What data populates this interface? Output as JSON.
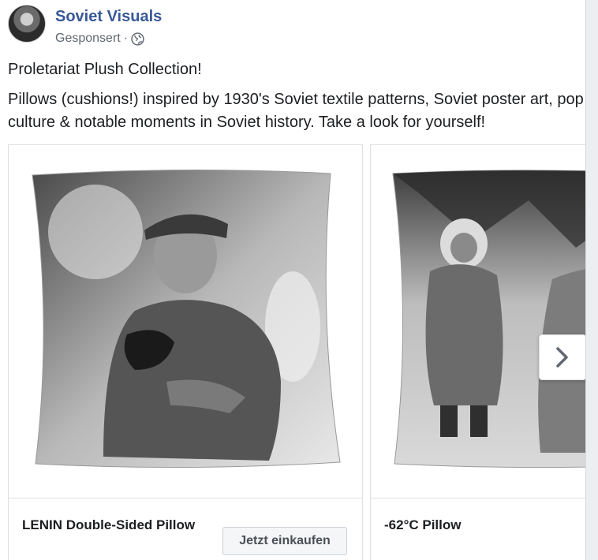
{
  "post": {
    "page_name": "Soviet Visuals",
    "sponsored_label": "Gesponsert",
    "separator": "·",
    "audience_icon": "globe-icon",
    "text_line1": "Proletariat Plush Collection!",
    "text_line2": "Pillows (cushions!) inspired by 1930's Soviet textile patterns, Soviet poster art, pop culture & notable moments in Soviet history. Take a look for yourself!"
  },
  "carousel": {
    "cards": [
      {
        "title": "LENIN Double-Sided Pillow",
        "cta_label": "Jetzt einkaufen",
        "image": "lenin-pillow-photo"
      },
      {
        "title": "-62°C Pillow",
        "image": "children-winter-pillow-photo"
      }
    ],
    "next_icon": "chevron-right-icon"
  },
  "colors": {
    "page_name": "#385898",
    "meta": "#606770",
    "text": "#1c1e21",
    "border": "#dddfe2"
  }
}
